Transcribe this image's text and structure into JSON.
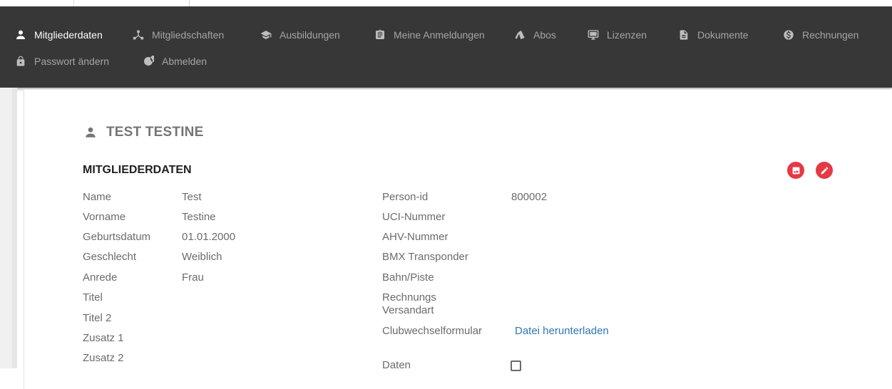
{
  "nav": {
    "items": [
      {
        "label": "Mitgliederdaten",
        "icon": "person-icon",
        "active": true
      },
      {
        "label": "Mitgliedschaften",
        "icon": "hub-icon"
      },
      {
        "label": "Ausbildungen",
        "icon": "graduation-cap-icon"
      },
      {
        "label": "Meine Anmeldungen",
        "icon": "clipboard-icon"
      },
      {
        "label": "Abos",
        "icon": "cards-icon"
      },
      {
        "label": "Lizenzen",
        "icon": "monitor-icon"
      },
      {
        "label": "Dokumente",
        "icon": "document-icon"
      },
      {
        "label": "Rechnungen",
        "icon": "dollar-circle-icon"
      },
      {
        "label": "Passwort ändern",
        "icon": "lock-icon"
      },
      {
        "label": "Abmelden",
        "icon": "power-icon"
      }
    ]
  },
  "page": {
    "title": "TEST TESTINE",
    "section_title": "MITGLIEDERDATEN",
    "actions": [
      {
        "icon": "image-icon",
        "color": "#e53946"
      },
      {
        "icon": "pencil-icon",
        "color": "#e53946"
      }
    ]
  },
  "fields_left": [
    {
      "label": "Name",
      "value": "Test"
    },
    {
      "label": "Vorname",
      "value": "Testine"
    },
    {
      "label": "Geburtsdatum",
      "value": "01.01.2000"
    },
    {
      "label": "Geschlecht",
      "value": "Weiblich"
    },
    {
      "label": "Anrede",
      "value": "Frau"
    },
    {
      "label": "Titel",
      "value": ""
    },
    {
      "label": "Titel 2",
      "value": ""
    },
    {
      "label": "Zusatz 1",
      "value": ""
    },
    {
      "label": "Zusatz 2",
      "value": ""
    }
  ],
  "fields_right": [
    {
      "label": "Person-id",
      "value": "800002"
    },
    {
      "label": "UCI-Nummer",
      "value": ""
    },
    {
      "label": "AHV-Nummer",
      "value": ""
    },
    {
      "label": "BMX Transponder",
      "value": ""
    },
    {
      "label": "Bahn/Piste",
      "value": ""
    },
    {
      "label": "Rechnungs",
      "value": ""
    },
    {
      "label": "Versandart",
      "value": ""
    },
    {
      "label": "Clubwechselformular",
      "value": "Datei herunterladen"
    },
    {
      "label": "Daten",
      "value": ""
    }
  ],
  "colors": {
    "navbar": "#373737",
    "accent": "#e53946",
    "link": "#2f76b6"
  }
}
